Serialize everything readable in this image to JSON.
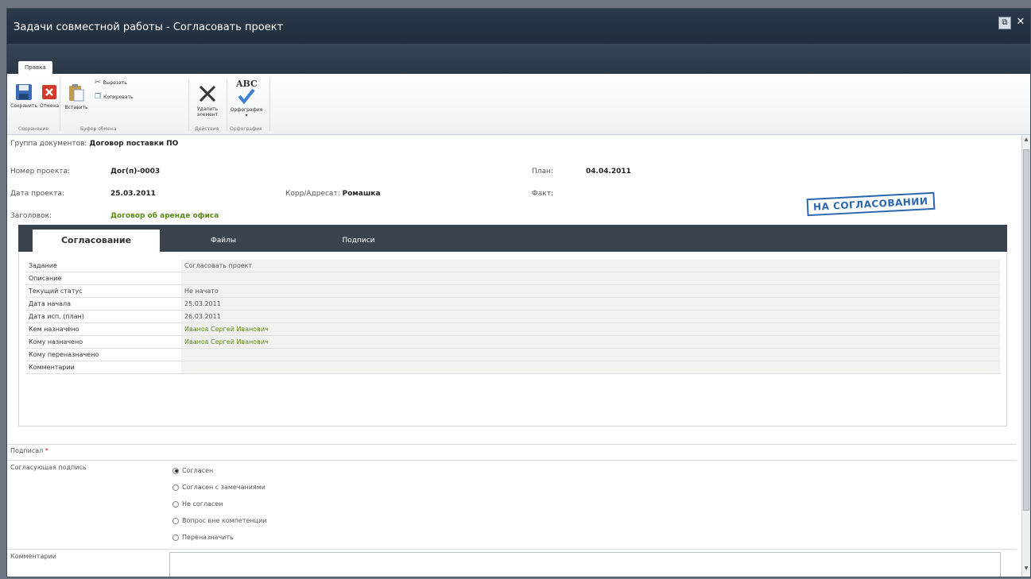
{
  "window": {
    "title": "Задачи совместной работы - Согласовать проект",
    "restore_label": "⧉",
    "close_label": "✕"
  },
  "ribbon": {
    "tab_label": "Правка",
    "buttons": {
      "save": "Сохранить",
      "cancel": "Отмена",
      "paste": "Вставить",
      "cut": "Вырезать",
      "copy": "Копировать",
      "delete_line1": "Удалить",
      "delete_line2": "элемент",
      "spelling": "Орфография",
      "spelling_arrow": "▾",
      "spelling_icon_text": "ABC"
    },
    "groups": {
      "save": "Сохранение",
      "clipboard": "Буфер обмена",
      "actions": "Действия",
      "spelling": "Орфография"
    }
  },
  "header": {
    "doc_group_label": "Группа документов:",
    "doc_group_value": "Договор поставки ПО",
    "project_number_label": "Номер проекта:",
    "project_number_value": "Дог(п)-0003",
    "plan_label": "План:",
    "plan_value": "04.04.2011",
    "project_date_label": "Дата проекта:",
    "project_date_value": "25.03.2011",
    "correspondent_label": "Корр/Адресат:",
    "correspondent_value": "Ромашка",
    "fact_label": "Факт:",
    "title_label": "Заголовок:",
    "title_value": "Договор об аренде офиса",
    "status_stamp": "НА СОГЛАСОВАНИИ"
  },
  "tabs": [
    {
      "label": "Согласование",
      "active": true
    },
    {
      "label": "Файлы",
      "active": false
    },
    {
      "label": "Подписи",
      "active": false
    }
  ],
  "task_fields": [
    {
      "label": "Задание",
      "value": "Согласовать проект",
      "green": false
    },
    {
      "label": "Описание",
      "value": "",
      "green": false
    },
    {
      "label": "Текущий статус",
      "value": "Не начато",
      "green": false
    },
    {
      "label": "Дата начала",
      "value": "25.03.2011",
      "green": false
    },
    {
      "label": "Дата исп. (план)",
      "value": "26.03.2011",
      "green": false
    },
    {
      "label": "Кем назначено",
      "value": "Иванов Сергей Иванович",
      "green": true
    },
    {
      "label": "Кому назначено",
      "value": "Иванов Сергей Иванович",
      "green": true
    },
    {
      "label": "Кому переназначено",
      "value": "",
      "green": false
    },
    {
      "label": "Комментарии",
      "value": "",
      "green": false
    }
  ],
  "form": {
    "signed_label": "Подписал",
    "required_mark": "*",
    "approval_label": "Согласующая подпись",
    "options": [
      {
        "label": "Согласен",
        "checked": true
      },
      {
        "label": "Согласен с замечаниями",
        "checked": false
      },
      {
        "label": "Не согласен",
        "checked": false
      },
      {
        "label": "Вопрос вне компетенции",
        "checked": false
      },
      {
        "label": "Переназначить",
        "checked": false
      }
    ],
    "comments_label": "Комментарии",
    "comments_value": ""
  },
  "colors": {
    "accent_green": "#5b8a1a",
    "stamp_blue": "#2a67b0",
    "titlebar": "#1f2d3c"
  }
}
